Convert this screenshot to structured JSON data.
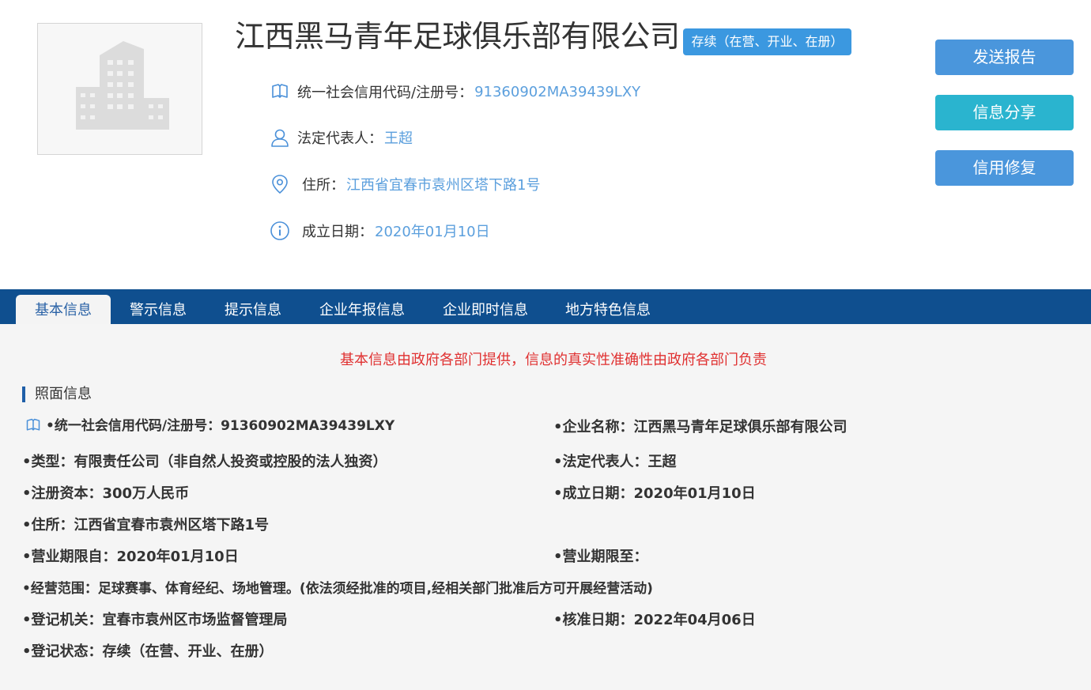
{
  "company": {
    "name": "江西黑马青年足球俱乐部有限公司",
    "status_badge": "存续（在营、开业、在册）"
  },
  "header_info": [
    {
      "icon": "book-icon",
      "label": "统一社会信用代码/注册号：",
      "value": "91360902MA39439LXY"
    },
    {
      "icon": "person-icon",
      "label": "法定代表人：",
      "value": "王超"
    },
    {
      "icon": "location-pin-icon",
      "label": "住所：",
      "value": "江西省宜春市袁州区塔下路1号"
    },
    {
      "icon": "info-circle-icon",
      "label": "成立日期：",
      "value": "2020年01月10日"
    }
  ],
  "actions": {
    "send_report": "发送报告",
    "share": "信息分享",
    "credit_repair": "信用修复"
  },
  "tabs": [
    "基本信息",
    "警示信息",
    "提示信息",
    "企业年报信息",
    "企业即时信息",
    "地方特色信息"
  ],
  "notice": "基本信息由政府各部门提供，信息的真实性准确性由政府各部门负责",
  "section_title": "照面信息",
  "fields": {
    "credit_code": "•统一社会信用代码/注册号：91360902MA39439LXY",
    "company_name": "•企业名称：江西黑马青年足球俱乐部有限公司",
    "type": "•类型：有限责任公司（非自然人投资或控股的法人独资）",
    "legal_rep": "•法定代表人：王超",
    "capital": "•注册资本：300万人民币",
    "established": "•成立日期：2020年01月10日",
    "address": "•住所：江西省宜春市袁州区塔下路1号",
    "period_from": "•营业期限自：2020年01月10日",
    "period_to": "•营业期限至：",
    "scope": "•经营范围：足球赛事、体育经纪、场地管理。(依法须经批准的项目,经相关部门批准后方可开展经营活动)",
    "authority": "•登记机关：宜春市袁州区市场监督管理局",
    "approval_date": "•核准日期：2022年04月06日",
    "reg_status": "•登记状态：存续（在营、开业、在册）"
  },
  "colors": {
    "tabbar": "#0f4f8f",
    "link_value": "#5b9fdd",
    "notice": "#e03131",
    "button_blue": "#4a96dc",
    "button_teal": "#2ab4cf"
  }
}
